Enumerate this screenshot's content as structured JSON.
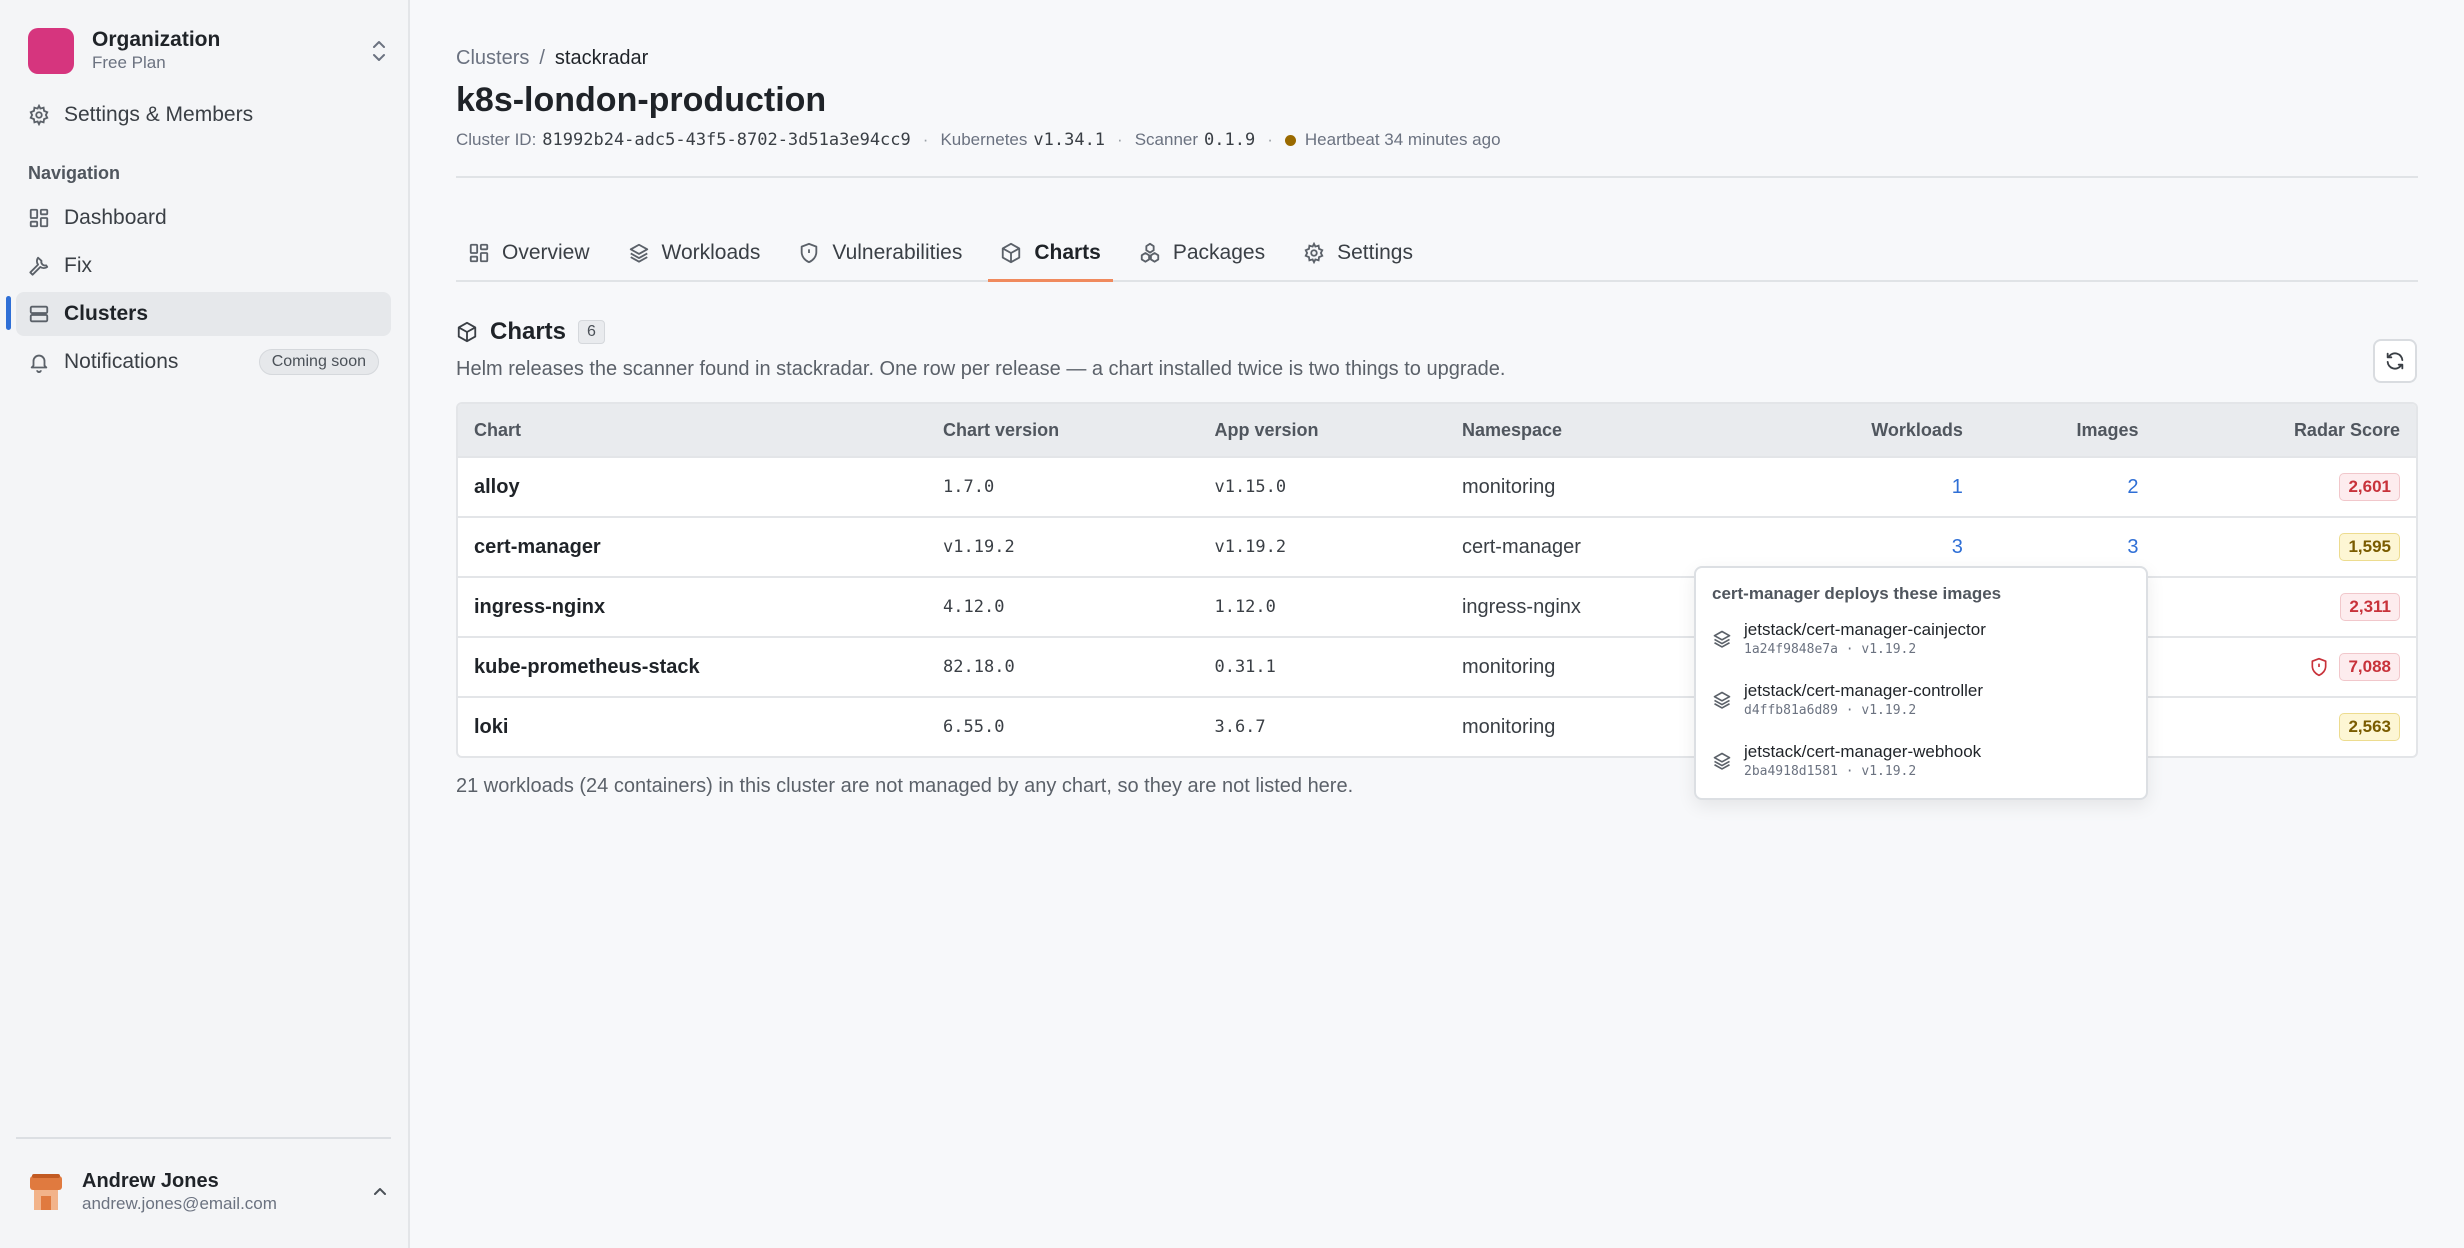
{
  "org": {
    "name": "Organization",
    "plan": "Free Plan"
  },
  "sidebar": {
    "settings_label": "Settings & Members",
    "nav_label": "Navigation",
    "items": [
      {
        "label": "Dashboard",
        "icon": "dashboard-icon"
      },
      {
        "label": "Fix",
        "icon": "wrench-icon"
      },
      {
        "label": "Clusters",
        "icon": "server-icon",
        "active": true
      },
      {
        "label": "Notifications",
        "icon": "bell-icon",
        "badge": "Coming soon"
      }
    ]
  },
  "user": {
    "name": "Andrew Jones",
    "email": "andrew.jones@email.com"
  },
  "breadcrumb": {
    "parent": "Clusters",
    "separator": "/",
    "current": "stackradar"
  },
  "page": {
    "title": "k8s-london-production",
    "meta": {
      "cluster_id_label": "Cluster ID:",
      "cluster_id": "81992b24-adc5-43f5-8702-3d51a3e94cc9",
      "kubernetes_label": "Kubernetes",
      "kubernetes_version": "v1.34.1",
      "scanner_label": "Scanner",
      "scanner_version": "0.1.9",
      "heartbeat": "Heartbeat 34 minutes ago",
      "sep": "·"
    }
  },
  "tabs": [
    {
      "label": "Overview",
      "icon": "grid-icon"
    },
    {
      "label": "Workloads",
      "icon": "layers-icon"
    },
    {
      "label": "Vulnerabilities",
      "icon": "shield-icon"
    },
    {
      "label": "Charts",
      "icon": "box-icon",
      "active": true
    },
    {
      "label": "Packages",
      "icon": "packages-icon"
    },
    {
      "label": "Settings",
      "icon": "gear-icon"
    }
  ],
  "section": {
    "title": "Charts",
    "count": "6",
    "description": "Helm releases the scanner found in stackradar. One row per release — a chart installed twice is two things to upgrade."
  },
  "table": {
    "headers": {
      "chart": "Chart",
      "chart_version": "Chart version",
      "app_version": "App version",
      "namespace": "Namespace",
      "workloads": "Workloads",
      "images": "Images",
      "radar_score": "Radar Score"
    },
    "rows": [
      {
        "chart": "alloy",
        "chart_version": "1.7.0",
        "app_version": "v1.15.0",
        "namespace": "monitoring",
        "workloads": "1",
        "images": "2",
        "score": "2,601"
      },
      {
        "chart": "cert-manager",
        "chart_version": "v1.19.2",
        "app_version": "v1.19.2",
        "namespace": "cert-manager",
        "workloads": "3",
        "images": "3",
        "score": "1,595"
      },
      {
        "chart": "ingress-nginx",
        "chart_version": "4.12.0",
        "app_version": "1.12.0",
        "namespace": "ingress-nginx",
        "workloads": "",
        "images": "",
        "score": "2,311"
      },
      {
        "chart": "kube-prometheus-stack",
        "chart_version": "82.18.0",
        "app_version": "0.31.1",
        "namespace": "monitoring",
        "workloads": "",
        "images": "",
        "score": "7,088"
      },
      {
        "chart": "loki",
        "chart_version": "6.55.0",
        "app_version": "3.6.7",
        "namespace": "monitoring",
        "workloads": "",
        "images": "",
        "score": "2,563"
      }
    ]
  },
  "footnote": "21 workloads (24 containers) in this cluster are not managed by any chart, so they are not listed here.",
  "popover": {
    "title": "cert-manager deploys these images",
    "items": [
      {
        "name": "jetstack/cert-manager-cainjector",
        "digest": "1a24f9848e7a",
        "version": "v1.19.2"
      },
      {
        "name": "jetstack/cert-manager-controller",
        "digest": "d4ffb81a6d89",
        "version": "v1.19.2"
      },
      {
        "name": "jetstack/cert-manager-webhook",
        "digest": "2ba4918d1581",
        "version": "v1.19.2"
      }
    ],
    "sep": "·"
  },
  "colors": {
    "accent": "#2f6fd6",
    "tab_underline": "#f08a5d",
    "org_logo": "#d6357e",
    "score_red": "#c8323a",
    "score_yellow": "#7a5b00",
    "heartbeat_dot": "#9a6a00"
  }
}
